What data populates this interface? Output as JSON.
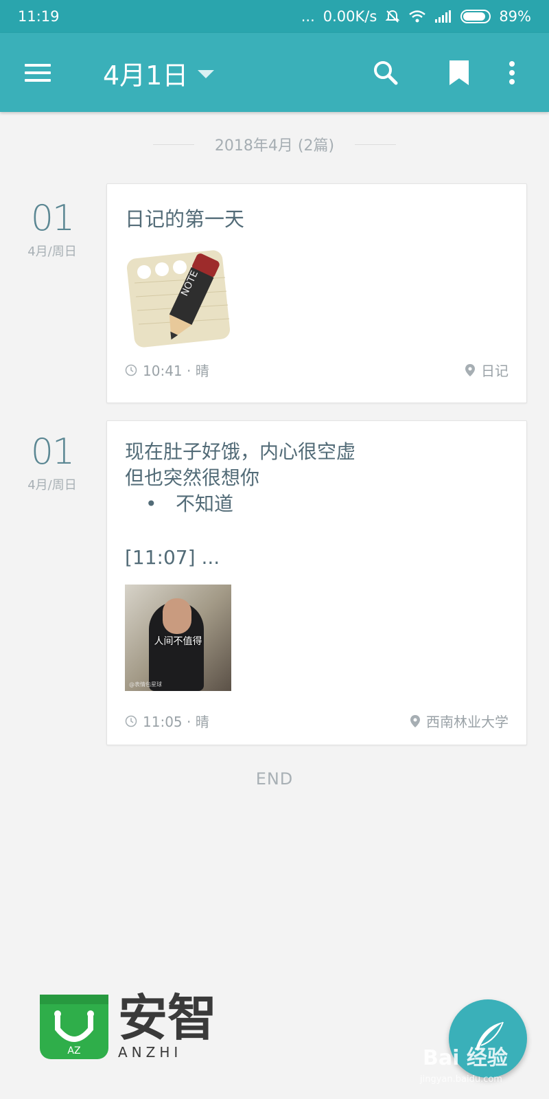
{
  "status_bar": {
    "time": "11:19",
    "dots": "...",
    "network_speed": "0.00K/s",
    "battery": "89%",
    "battery_level": 0.89
  },
  "app_bar": {
    "title": "4月1日",
    "menu_icon": "hamburger-menu-icon",
    "search_icon": "search-icon",
    "bookmark_icon": "bookmark-icon",
    "more_icon": "more-vertical-icon"
  },
  "month_header": "2018年4月 (2篇)",
  "entries": [
    {
      "day": "01",
      "sub": "4月/周日",
      "title": "日记的第一天",
      "time": "10:41 · 晴",
      "location": "日记"
    },
    {
      "day": "01",
      "sub": "4月/周日",
      "line1": "现在肚子好饿，内心很空虚",
      "line2": "但也突然很想你",
      "bullet": "•",
      "bullet_text": "不知道",
      "stamp": "[11:07] ...",
      "photo_caption": "人间不值得",
      "photo_watermark": "@表情包星球",
      "time": "11:05 · 晴",
      "location": "西南林业大学"
    }
  ],
  "end_label": "END",
  "logo": {
    "cn": "安智",
    "en": "ANZHI",
    "bag_letters": "AZ"
  },
  "fab_icon": "feather-pen-icon",
  "watermark": {
    "brand": "Bai 经验",
    "url": "jingyan.baidu.com"
  }
}
